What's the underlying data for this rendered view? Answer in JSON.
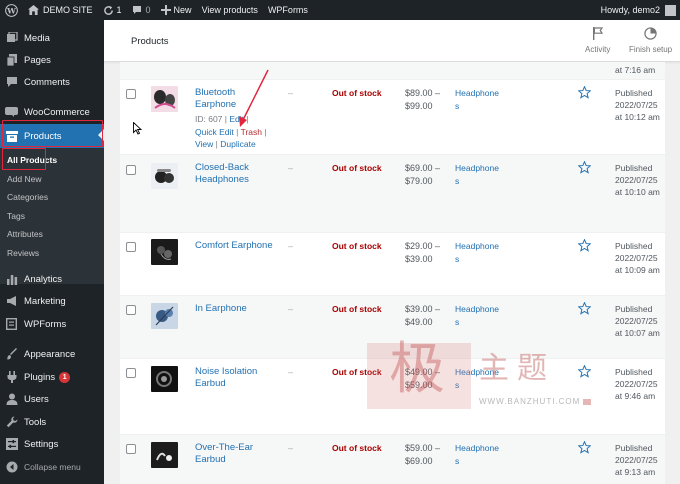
{
  "admin_bar": {
    "site_name": "DEMO SITE",
    "updates_count": "1",
    "comments_count": "0",
    "new_label": "New",
    "view_products": "View products",
    "wpforms": "WPForms",
    "greeting": "Howdy, demo2"
  },
  "sidebar": {
    "media": "Media",
    "pages": "Pages",
    "comments": "Comments",
    "woocommerce": "WooCommerce",
    "products": "Products",
    "submenu": {
      "all_products": "All Products",
      "add_new": "Add New",
      "categories": "Categories",
      "tags": "Tags",
      "attributes": "Attributes",
      "reviews": "Reviews"
    },
    "analytics": "Analytics",
    "marketing": "Marketing",
    "wpforms": "WPForms",
    "appearance": "Appearance",
    "plugins": "Plugins",
    "plugins_badge": "1",
    "users": "Users",
    "tools": "Tools",
    "settings": "Settings",
    "collapse": "Collapse menu"
  },
  "header": {
    "title": "Products",
    "activity": "Activity",
    "finish_setup": "Finish setup"
  },
  "top_partial_date": "at 7:16 am",
  "products": [
    {
      "name": "Bluetooth Earphone",
      "id_text": "ID: 607",
      "sep": "|",
      "edit": "Edit",
      "quick_edit": "Quick Edit",
      "trash": "Trash",
      "view": "View",
      "duplicate": "Duplicate",
      "sku": "–",
      "stock": "Out of stock",
      "price_from": "$89.00 –",
      "price_to": "$99.00",
      "category": "Headphone",
      "category_tail": "s",
      "status": "Published",
      "date": "2022/07/25",
      "time": "at 10:12 am"
    },
    {
      "name": "Closed-Back Headphones",
      "sku": "–",
      "stock": "Out of stock",
      "price_from": "$69.00 –",
      "price_to": "$79.00",
      "category": "Headphone",
      "category_tail": "s",
      "status": "Published",
      "date": "2022/07/25",
      "time": "at 10:10 am"
    },
    {
      "name": "Comfort Earphone",
      "sku": "–",
      "stock": "Out of stock",
      "price_from": "$29.00 –",
      "price_to": "$39.00",
      "category": "Headphone",
      "category_tail": "s",
      "status": "Published",
      "date": "2022/07/25",
      "time": "at 10:09 am"
    },
    {
      "name": "In Earphone",
      "sku": "–",
      "stock": "Out of stock",
      "price_from": "$39.00 –",
      "price_to": "$49.00",
      "category": "Headphone",
      "category_tail": "s",
      "status": "Published",
      "date": "2022/07/25",
      "time": "at 10:07 am"
    },
    {
      "name": "Noise Isolation Earbud",
      "sku": "–",
      "stock": "Out of stock",
      "price_from": "$49.00 –",
      "price_to": "$59.00",
      "category": "Headphone",
      "category_tail": "s",
      "status": "Published",
      "date": "2022/07/25",
      "time": "at 9:46 am"
    },
    {
      "name": "Over-The-Ear Earbud",
      "sku": "–",
      "stock": "Out of stock",
      "price_from": "$59.00 –",
      "price_to": "$69.00",
      "category": "Headphone",
      "category_tail": "s",
      "status": "Published",
      "date": "2022/07/25",
      "time": "at 9:13 am"
    }
  ],
  "watermark": {
    "seal_char": "极",
    "text": "主题",
    "url": "WWW.BANZHUTI.COM"
  },
  "colors": {
    "admin_dark": "#1d2327",
    "accent_blue": "#2271b1",
    "out_of_stock_red": "#aa0000",
    "annotation_red": "#e2263b"
  }
}
